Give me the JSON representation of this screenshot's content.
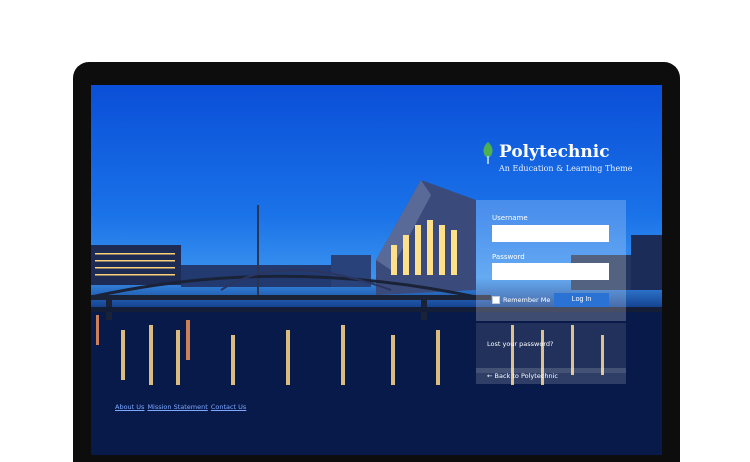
{
  "brand": {
    "title": "Polytechnic",
    "subtitle": "An Education & Learning Theme",
    "leaf_color": "#4caf50"
  },
  "login": {
    "username_label": "Username",
    "username_value": "",
    "password_label": "Password",
    "password_value": "",
    "remember_label": "Remember Me",
    "login_button": "Log In",
    "accent": "#2a72d4"
  },
  "links": {
    "lost_password": "Lost your password?",
    "back": "← Back to Polytechnic"
  },
  "footer": {
    "items": [
      "About Us",
      "Mission Statement",
      "Contact Us"
    ]
  }
}
